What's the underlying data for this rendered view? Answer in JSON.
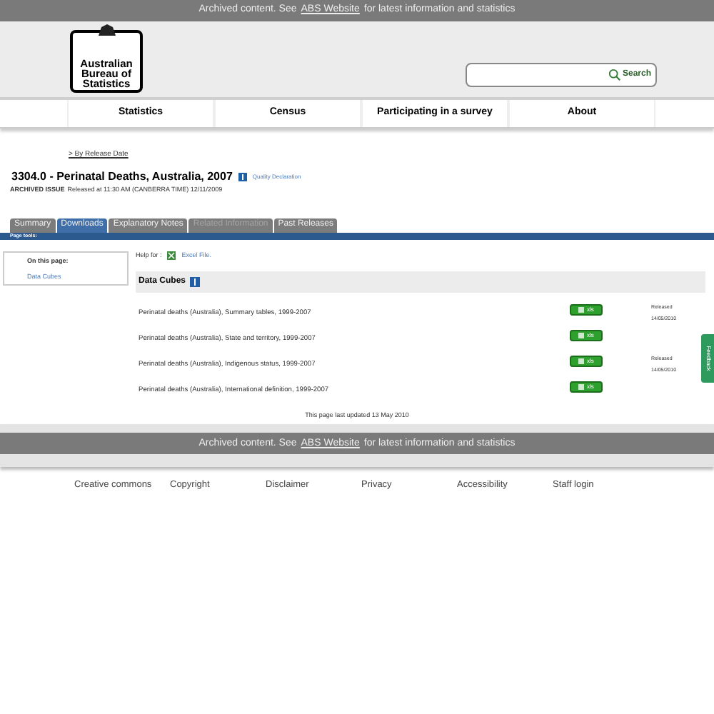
{
  "banner_top": {
    "before": "Archived content. See",
    "link": "ABS Website",
    "after": "for latest information and statistics"
  },
  "logo": {
    "lines": [
      "Australian",
      "Bureau of",
      "Statistics"
    ]
  },
  "search": {
    "button": "Search"
  },
  "nav": [
    "Statistics",
    "Census",
    "Participating in a survey",
    "About"
  ],
  "breadcrumb": "> By Release Date",
  "title": "3304.0 - Perinatal Deaths, Australia, 2007",
  "quality_link": "Quality Declaration",
  "archived": {
    "label": "ARCHIVED ISSUE",
    "text": "Released at 11:30 AM (CANBERRA TIME) 12/11/2009"
  },
  "tabs": [
    {
      "label": "Summary",
      "selected": false,
      "disabled": false
    },
    {
      "label": "Downloads",
      "selected": true,
      "disabled": false
    },
    {
      "label": "Explanatory Notes",
      "selected": false,
      "disabled": false
    },
    {
      "label": "Related Information",
      "selected": false,
      "disabled": true
    },
    {
      "label": "Past Releases",
      "selected": false,
      "disabled": false
    }
  ],
  "page_tools": "Page tools:",
  "on_this_page": {
    "heading": "On this page:",
    "links": [
      "Data Cubes"
    ]
  },
  "help": {
    "label": "Help for :",
    "link": "Excel File."
  },
  "section_title": "Data Cubes",
  "rows": [
    {
      "name": "Perinatal deaths (Australia), Summary tables, 1999-2007",
      "button": "xls",
      "released": [
        "Released",
        "14/05/2010"
      ]
    },
    {
      "name": "Perinatal deaths (Australia), State and territory, 1999-2007",
      "button": "xls",
      "released": []
    },
    {
      "name": "Perinatal deaths (Australia), Indigenous status, 1999-2007",
      "button": "xls",
      "released": [
        "Released",
        "14/05/2010"
      ]
    },
    {
      "name": "Perinatal deaths (Australia), International definition, 1999-2007",
      "button": "xls",
      "released": []
    }
  ],
  "last_updated": "This page last updated 13 May 2010",
  "banner_bottom": {
    "before": "Archived content. See",
    "link": "ABS Website",
    "after": "for latest information and statistics"
  },
  "footer_links": [
    "Creative commons",
    "Copyright",
    "Disclaimer",
    "Privacy",
    "Accessibility",
    "Staff login"
  ],
  "feedback": "Feedback"
}
